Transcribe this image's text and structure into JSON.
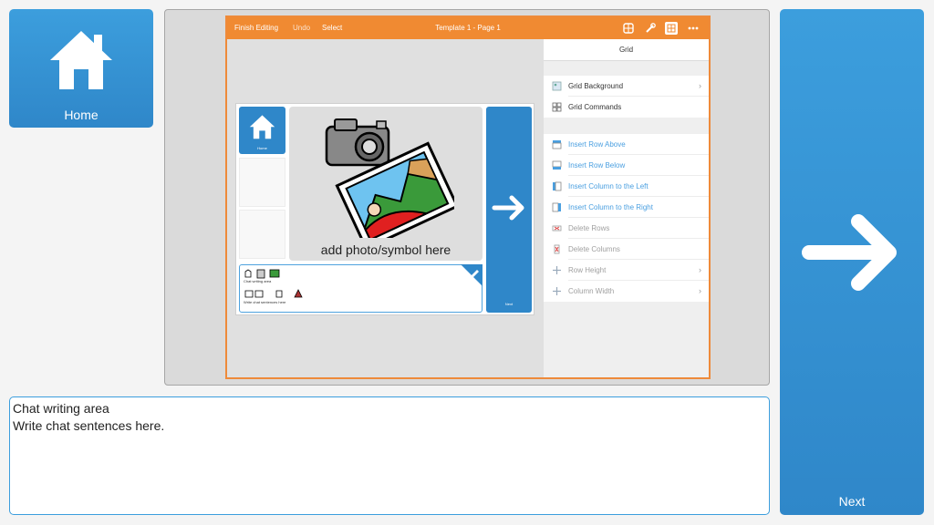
{
  "home_button": {
    "label": "Home",
    "icon": "home-icon"
  },
  "next_button": {
    "label": "Next",
    "icon": "arrow-right-icon"
  },
  "screenshot": {
    "topbar": {
      "finish_editing": "Finish Editing",
      "undo": "Undo",
      "select": "Select",
      "title": "Template 1 - Page 1",
      "icons": [
        "grid-palette-icon",
        "tool-icon",
        "grid-icon",
        "more-icon"
      ]
    },
    "board": {
      "home_label": "Home",
      "photo_caption": "add photo/symbol here",
      "next_label": "Next",
      "chat_line1": "Chat writing area",
      "chat_line2": "Write chat sentences here"
    },
    "panel": {
      "header": "Grid",
      "group1": [
        {
          "label": "Grid Background",
          "chevron": true
        },
        {
          "label": "Grid Commands",
          "chevron": false
        }
      ],
      "group2": [
        {
          "label": "Insert Row Above"
        },
        {
          "label": "Insert Row Below"
        },
        {
          "label": "Insert Column to the Left"
        },
        {
          "label": "Insert Column to the Right"
        },
        {
          "label": "Delete Rows"
        },
        {
          "label": "Delete Columns"
        },
        {
          "label": "Row Height",
          "chevron": true
        },
        {
          "label": "Column Width",
          "chevron": true
        }
      ],
      "chevron_glyph": "›"
    }
  },
  "chat_area": {
    "line1": "Chat writing area",
    "line2": "Write chat sentences here."
  },
  "colors": {
    "button_blue": "#3c9edd",
    "orange": "#f08a32",
    "link_blue": "#4a9fe0",
    "disabled_gray": "#a0a0a0"
  }
}
